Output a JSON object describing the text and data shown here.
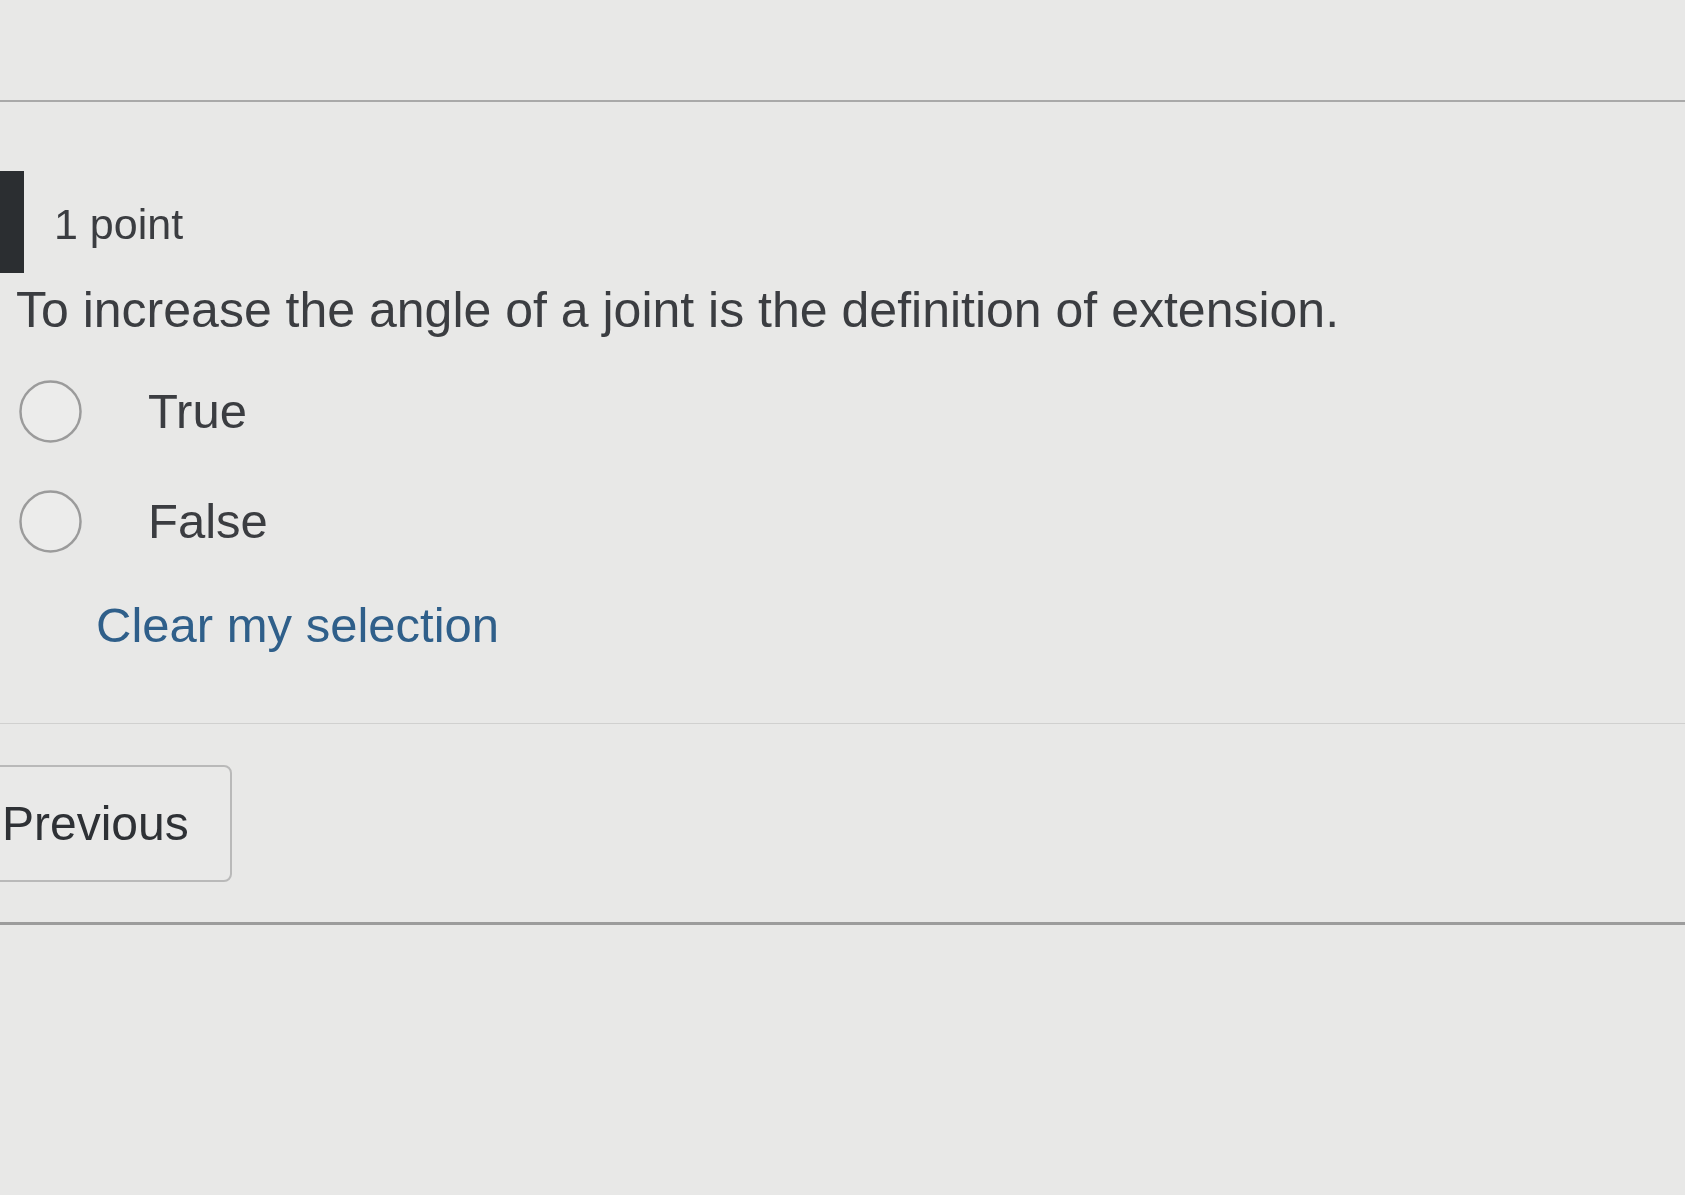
{
  "question": {
    "points": "1 point",
    "text": "To increase the angle of a joint is the definition of extension.",
    "options": [
      {
        "label": "True",
        "selected": false
      },
      {
        "label": "False",
        "selected": false
      }
    ],
    "clear_link": "Clear my selection"
  },
  "navigation": {
    "previous_button": "Previous"
  }
}
